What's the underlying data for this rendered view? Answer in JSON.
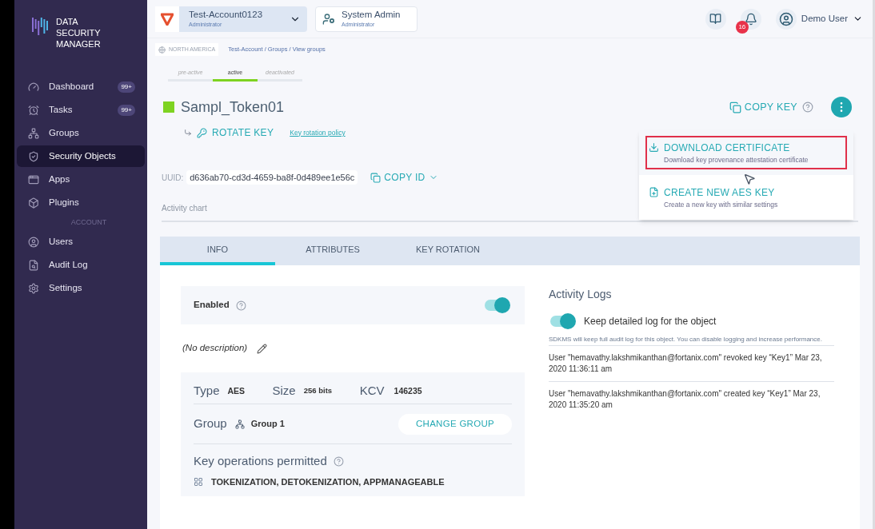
{
  "app": {
    "title": "DATA SECURITY MANAGER"
  },
  "sidebar": {
    "items": [
      {
        "kind": "item",
        "label": "Dashboard",
        "badge": "99+",
        "selected": false
      },
      {
        "kind": "item",
        "label": "Tasks",
        "badge": "99+",
        "selected": false
      },
      {
        "kind": "item",
        "label": "Groups",
        "selected": false
      },
      {
        "kind": "item",
        "label": "Security Objects",
        "selected": true
      },
      {
        "kind": "item",
        "label": "Apps",
        "selected": false
      },
      {
        "kind": "item",
        "label": "Plugins",
        "selected": false
      },
      {
        "kind": "section",
        "label": "ACCOUNT"
      },
      {
        "kind": "item",
        "label": "Users",
        "selected": false
      },
      {
        "kind": "item",
        "label": "Audit Log",
        "selected": false
      },
      {
        "kind": "item",
        "label": "Settings",
        "selected": false
      }
    ]
  },
  "header": {
    "account": {
      "name": "Test-Account0123",
      "role": "Administrator"
    },
    "admin": {
      "name": "System Admin",
      "role": "Administrator"
    },
    "notification_count": "16",
    "user": "Demo User"
  },
  "breadcrumb": {
    "region": "NORTH AMERICA",
    "path": "Test-Account / Groups / View groups"
  },
  "state_tabs": [
    {
      "label": "pre-active",
      "selected": false
    },
    {
      "label": "active",
      "selected": true
    },
    {
      "label": "deactivated",
      "selected": false
    }
  ],
  "object": {
    "name": "Sampl_Token01",
    "rotate_key": "ROTATE KEY",
    "rotation_policy": "Key rotation policy",
    "uuid_label": "UUID:",
    "uuid": "d636ab70-cd3d-4659-ba8f-0d489ee1e56c",
    "copy_id": "COPY ID",
    "copy_key": "COPY KEY"
  },
  "menu": [
    {
      "kind": "download",
      "title": "DOWNLOAD CERTIFICATE",
      "description": "Download key provenance attestation certificate",
      "highlighted": true
    },
    {
      "kind": "create",
      "title": "CREATE NEW AES KEY",
      "description": "Create a new key with similar settings",
      "highlighted": false
    }
  ],
  "activity_chart": {
    "label": "Activity chart"
  },
  "tabs": [
    {
      "label": "INFO",
      "selected": true
    },
    {
      "label": "ATTRIBUTES",
      "selected": false
    },
    {
      "label": "KEY ROTATION",
      "selected": false
    }
  ],
  "info": {
    "enabled": {
      "label": "Enabled",
      "on": true
    },
    "description": "(No description)",
    "type_label": "Type",
    "type": "AES",
    "size_label": "Size",
    "size": "256 bits",
    "kcv_label": "KCV",
    "kcv": "146235",
    "group_label": "Group",
    "group": "Group 1",
    "change_group": "CHANGE GROUP",
    "ops_label": "Key operations permitted",
    "ops": "TOKENIZATION, DETOKENIZATION, APPMANAGEABLE"
  },
  "activity_logs": {
    "title": "Activity Logs",
    "keep_log": {
      "label": "Keep detailed log for the object",
      "on": true
    },
    "note": "SDKMS will keep full audit log for this object. You can disable logging and increase performance.",
    "entries": [
      "User \"hemavathy.lakshmikanthan@fortanix.com\" revoked key “Key1” Mar 23, 2020 11:36:11 am",
      "User \"hemavathy.lakshmikanthan@fortanix.com\" created key “Key1” Mar 23, 2020 11:35:20 am"
    ]
  }
}
